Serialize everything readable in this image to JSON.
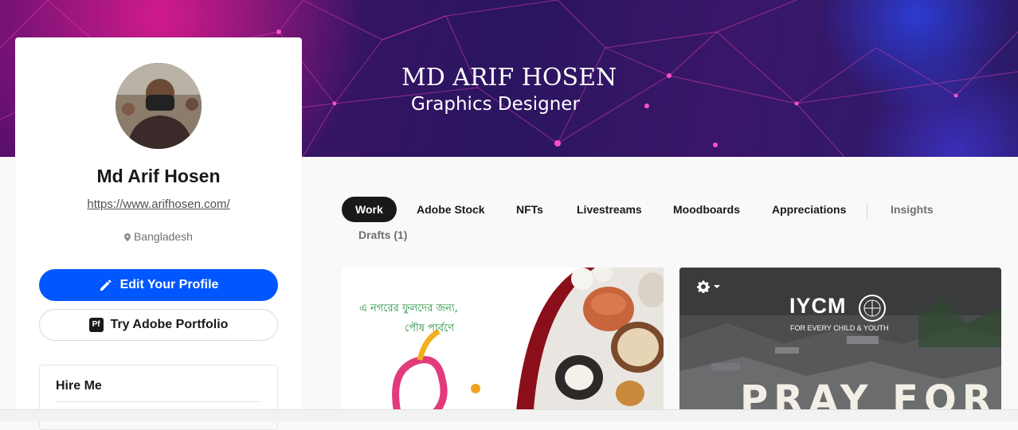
{
  "banner": {
    "name": "MD ARIF HOSEN",
    "role": "Graphics Designer"
  },
  "profile": {
    "name": "Md Arif Hosen",
    "url": "https://www.arifhosen.com/",
    "location": "Bangladesh",
    "edit_button": "Edit Your Profile",
    "portfolio_button": "Try Adobe Portfolio",
    "portfolio_badge": "Pf",
    "hire_title": "Hire Me"
  },
  "tabs": {
    "work": "Work",
    "adobe_stock": "Adobe Stock",
    "nfts": "NFTs",
    "livestreams": "Livestreams",
    "moodboards": "Moodboards",
    "appreciations": "Appreciations",
    "insights": "Insights",
    "drafts": "Drafts (1)"
  },
  "projects": [
    {
      "line1": "এ নগরের ফুলদের জন্য,",
      "line2": "পৌষ পার্বণে"
    },
    {
      "logo": "IYCM",
      "tagline": "FOR EVERY CHILD & YOUTH",
      "headline": "PRAY FOR"
    }
  ],
  "colors": {
    "accent": "#0057ff",
    "active_tab": "#191919",
    "banner_dark": "#2a1560",
    "banner_pink": "#d21a8c"
  },
  "icons": [
    "pencil-icon",
    "location-pin-icon",
    "gear-icon",
    "chevron-down-icon",
    "un-emblem-icon"
  ]
}
